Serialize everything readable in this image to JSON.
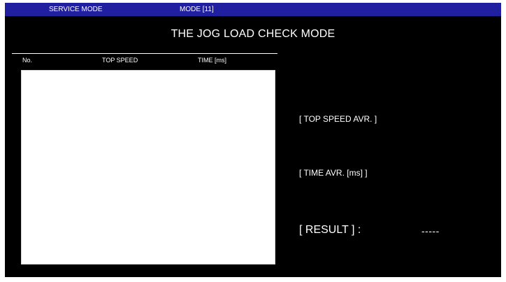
{
  "header": {
    "service_mode": "SERVICE MODE",
    "mode": "MODE [11]"
  },
  "title": "THE JOG LOAD CHECK MODE",
  "table": {
    "columns": [
      "No.",
      "TOP SPEED",
      "TIME [ms]"
    ],
    "rows": []
  },
  "summary": {
    "top_speed_avr_label": "[ TOP SPEED AVR. ]",
    "time_avr_label": "[ TIME AVR. [ms] ]",
    "result_label": "[ RESULT ] :",
    "result_value": "-----"
  },
  "colors": {
    "background": "#000000",
    "header_bar": "#1f1fa0",
    "text": "#ffffff",
    "list_background": "#ffffff"
  }
}
